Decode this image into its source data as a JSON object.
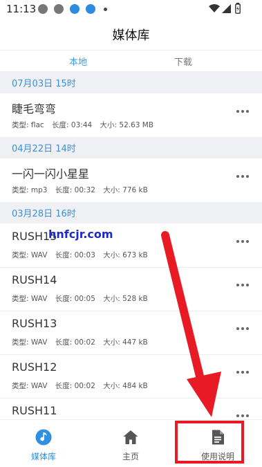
{
  "status_bar": {
    "time": "11:13",
    "icons": [
      "notification-icon",
      "notification-icon",
      "download-icon",
      "download-icon",
      "dot-icon",
      "wifi-icon",
      "signal-icon",
      "battery-icon"
    ]
  },
  "header": {
    "title": "媒体库"
  },
  "tabs": [
    {
      "label": "本地",
      "active": true
    },
    {
      "label": "下载",
      "active": false
    }
  ],
  "groups": [
    {
      "header": "07月03日  15时",
      "items": [
        {
          "name": "睫毛弯弯",
          "type_label": "类型: flac",
          "length_label": "长度: 03:44",
          "size_label": "大小: 52.63 MB"
        }
      ]
    },
    {
      "header": "04月22日  14时",
      "items": [
        {
          "name": "一闪一闪小星星",
          "type_label": "类型: mp3",
          "length_label": "长度: 00:32",
          "size_label": "大小: 776 kB"
        }
      ]
    },
    {
      "header": "03月28日  16时",
      "items": [
        {
          "name": "RUSH15",
          "type_label": "类型: WAV",
          "length_label": "长度: 00:03",
          "size_label": "大小: 673 kB"
        },
        {
          "name": "RUSH14",
          "type_label": "类型: WAV",
          "length_label": "长度: 00:05",
          "size_label": "大小: 528 kB"
        },
        {
          "name": "RUSH13",
          "type_label": "类型: WAV",
          "length_label": "长度: 00:02",
          "size_label": "大小: 447 kB"
        },
        {
          "name": "RUSH12",
          "type_label": "类型: WAV",
          "length_label": "长度: 00:02",
          "size_label": "大小: 484 kB"
        },
        {
          "name": "RUSH11"
        }
      ]
    }
  ],
  "watermark": "hnfcjr.com",
  "bottom_nav": [
    {
      "label": "媒体库",
      "icon": "music-note-icon",
      "active": true
    },
    {
      "label": "主页",
      "icon": "home-icon",
      "active": false
    },
    {
      "label": "使用说明",
      "icon": "document-icon",
      "active": false
    }
  ],
  "colors": {
    "accent": "#3b9be6",
    "annotation": "#e81a24",
    "group_bg": "#eef0f3",
    "watermark": "#1e2ac8"
  }
}
